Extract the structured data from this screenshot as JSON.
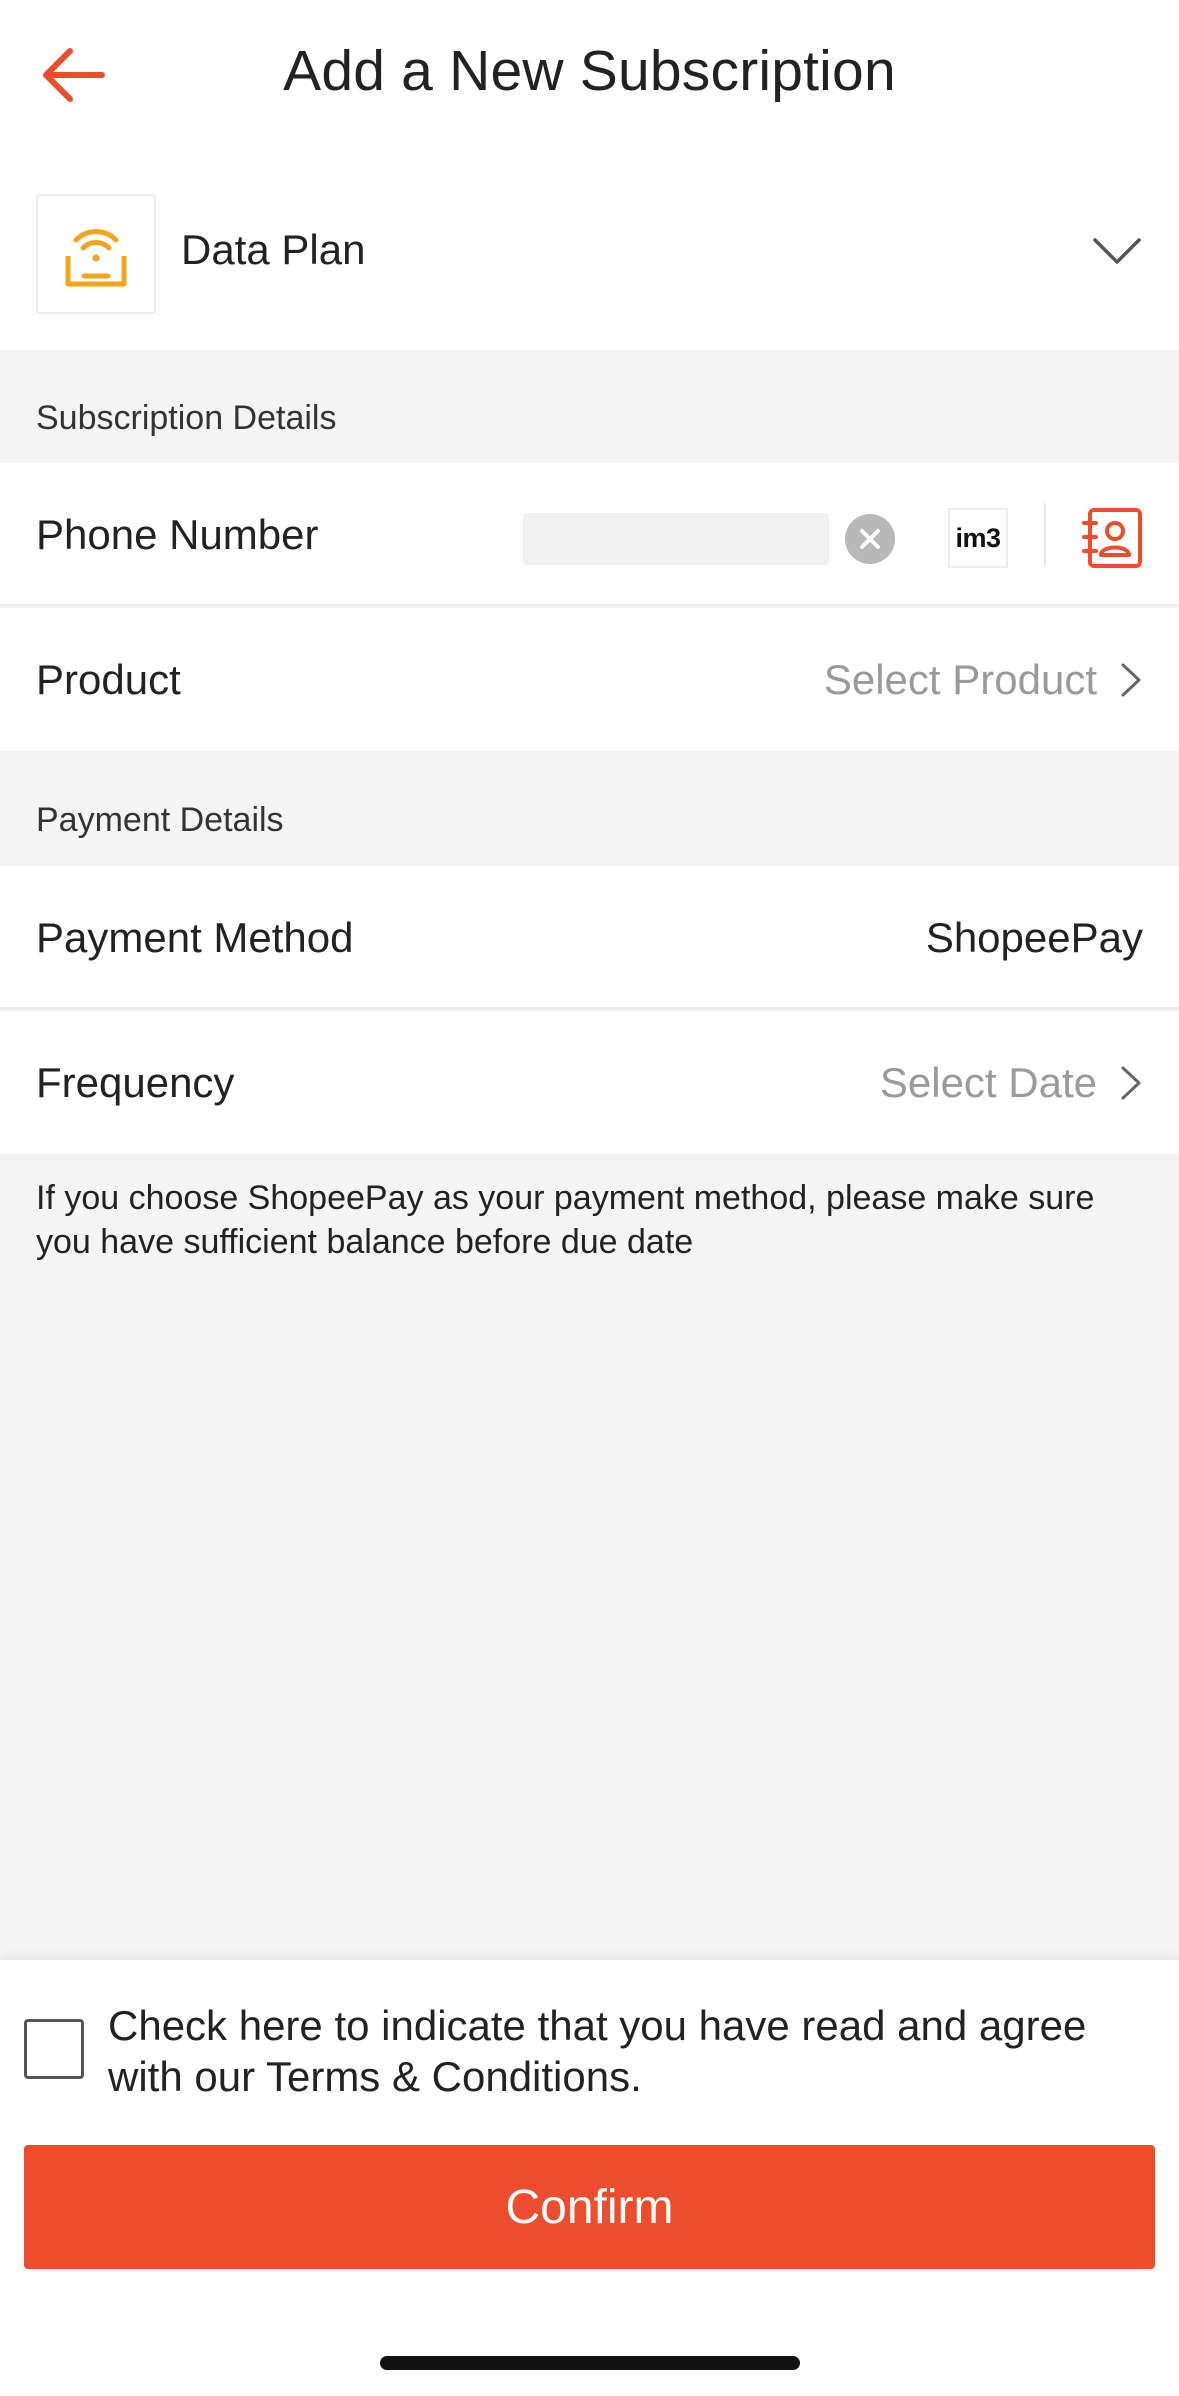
{
  "header": {
    "title": "Add a New Subscription",
    "back_icon": "arrow-left-icon",
    "accent_color": "#ee4d2d"
  },
  "plan": {
    "label": "Data Plan",
    "icon": "wifi-package-icon",
    "icon_color": "#f2a51a"
  },
  "subscription_details": {
    "title": "Subscription Details",
    "phone": {
      "label": "Phone Number",
      "value": "",
      "operator_logo_text": "im3"
    },
    "product": {
      "label": "Product",
      "placeholder": "Select Product"
    }
  },
  "payment_details": {
    "title": "Payment Details",
    "method": {
      "label": "Payment Method",
      "value": "ShopeePay"
    },
    "frequency": {
      "label": "Frequency",
      "placeholder": "Select Date"
    }
  },
  "notice": "If you choose ShopeePay as your payment method, please make sure you have sufficient balance before due date",
  "footer": {
    "terms_text": "Check here to indicate that you have read and agree with our Terms & Conditions.",
    "terms_checked": false,
    "confirm_label": "Confirm"
  }
}
